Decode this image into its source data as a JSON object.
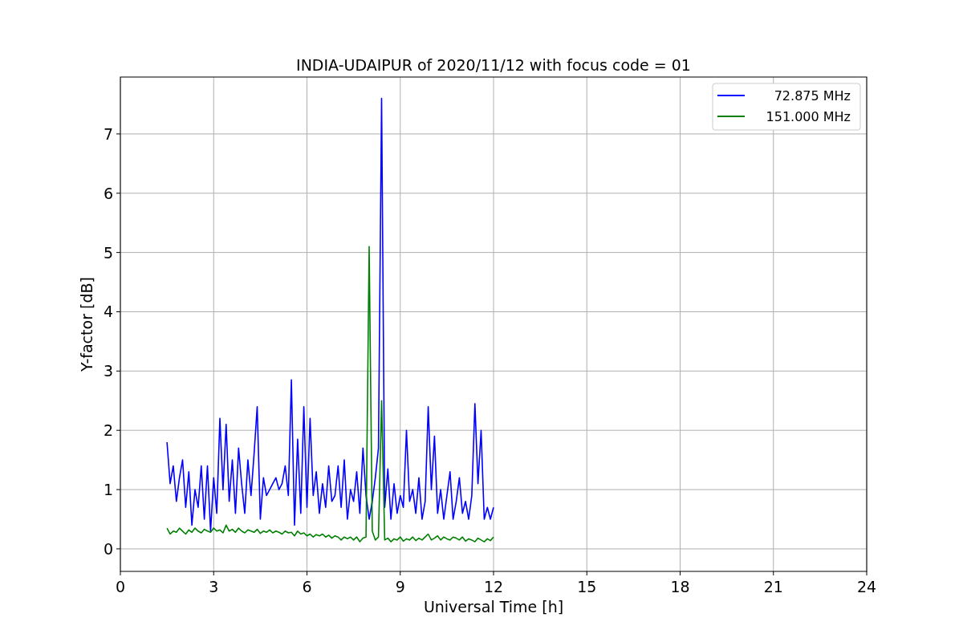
{
  "figure": {
    "chart_data": {
      "type": "line",
      "title": "INDIA-UDAIPUR of 2020/11/12 with focus code = 01",
      "xlabel": "Universal Time [h]",
      "ylabel": "Y-factor [dB]",
      "x": [
        1.5,
        1.6,
        1.7,
        1.8,
        1.9,
        2.0,
        2.1,
        2.2,
        2.3,
        2.4,
        2.5,
        2.6,
        2.7,
        2.8,
        2.9,
        3.0,
        3.1,
        3.2,
        3.3,
        3.4,
        3.5,
        3.6,
        3.7,
        3.8,
        3.9,
        4.0,
        4.1,
        4.2,
        4.3,
        4.4,
        4.5,
        4.6,
        4.7,
        4.8,
        4.9,
        5.0,
        5.1,
        5.2,
        5.3,
        5.4,
        5.5,
        5.6,
        5.7,
        5.8,
        5.9,
        6.0,
        6.1,
        6.2,
        6.3,
        6.4,
        6.5,
        6.6,
        6.7,
        6.8,
        6.9,
        7.0,
        7.1,
        7.2,
        7.3,
        7.4,
        7.5,
        7.6,
        7.7,
        7.8,
        7.9,
        8.0,
        8.1,
        8.2,
        8.3,
        8.4,
        8.5,
        8.6,
        8.7,
        8.8,
        8.9,
        9.0,
        9.1,
        9.2,
        9.3,
        9.4,
        9.5,
        9.6,
        9.7,
        9.8,
        9.9,
        10.0,
        10.1,
        10.2,
        10.3,
        10.4,
        10.5,
        10.6,
        10.7,
        10.8,
        10.9,
        11.0,
        11.1,
        11.2,
        11.3,
        11.4,
        11.5,
        11.6,
        11.7,
        11.8,
        11.9,
        12.0
      ],
      "series": [
        {
          "name": "72.875 MHz",
          "color": "#0000ff",
          "values": [
            1.8,
            1.1,
            1.4,
            0.8,
            1.2,
            1.5,
            0.7,
            1.3,
            0.4,
            1.0,
            0.7,
            1.4,
            0.5,
            1.4,
            0.3,
            1.2,
            0.6,
            2.2,
            1.0,
            2.1,
            0.8,
            1.5,
            0.6,
            1.7,
            1.1,
            0.6,
            1.5,
            0.9,
            1.6,
            2.4,
            0.5,
            1.2,
            0.9,
            1.0,
            1.1,
            1.2,
            1.0,
            1.1,
            1.4,
            0.9,
            2.85,
            0.4,
            1.85,
            0.6,
            2.4,
            0.7,
            2.2,
            0.9,
            1.3,
            0.6,
            1.1,
            0.7,
            1.4,
            0.8,
            0.9,
            1.4,
            0.7,
            1.5,
            0.5,
            1.0,
            0.8,
            1.3,
            0.6,
            1.7,
            0.9,
            0.5,
            0.8,
            1.2,
            1.7,
            7.6,
            0.7,
            1.35,
            0.5,
            1.1,
            0.6,
            0.9,
            0.7,
            2.0,
            0.8,
            1.0,
            0.6,
            1.2,
            0.5,
            0.8,
            2.4,
            1.0,
            1.9,
            0.6,
            1.0,
            0.5,
            0.9,
            1.3,
            0.5,
            0.8,
            1.2,
            0.6,
            0.8,
            0.5,
            0.9,
            2.45,
            1.1,
            2.0,
            0.5,
            0.7,
            0.5,
            0.7
          ]
        },
        {
          "name": "151.000 MHz",
          "color": "#008000",
          "values": [
            0.35,
            0.25,
            0.3,
            0.28,
            0.35,
            0.3,
            0.25,
            0.32,
            0.28,
            0.35,
            0.3,
            0.27,
            0.33,
            0.3,
            0.28,
            0.35,
            0.3,
            0.32,
            0.27,
            0.4,
            0.3,
            0.33,
            0.28,
            0.35,
            0.3,
            0.27,
            0.32,
            0.3,
            0.28,
            0.33,
            0.26,
            0.3,
            0.28,
            0.32,
            0.27,
            0.3,
            0.28,
            0.25,
            0.3,
            0.27,
            0.28,
            0.22,
            0.3,
            0.25,
            0.27,
            0.22,
            0.25,
            0.2,
            0.24,
            0.22,
            0.25,
            0.2,
            0.23,
            0.18,
            0.22,
            0.2,
            0.15,
            0.2,
            0.17,
            0.2,
            0.15,
            0.2,
            0.12,
            0.18,
            0.2,
            5.1,
            0.3,
            0.15,
            0.2,
            2.5,
            0.15,
            0.18,
            0.12,
            0.17,
            0.15,
            0.2,
            0.13,
            0.17,
            0.15,
            0.2,
            0.14,
            0.18,
            0.15,
            0.2,
            0.25,
            0.15,
            0.18,
            0.22,
            0.15,
            0.2,
            0.17,
            0.15,
            0.2,
            0.18,
            0.15,
            0.2,
            0.13,
            0.17,
            0.15,
            0.12,
            0.18,
            0.15,
            0.12,
            0.17,
            0.14,
            0.2
          ]
        }
      ],
      "xlim": [
        0,
        24
      ],
      "ylim": [
        -0.38,
        7.96
      ],
      "xticks": [
        0,
        3,
        6,
        9,
        12,
        15,
        18,
        21,
        24
      ],
      "yticks": [
        0,
        1,
        2,
        3,
        4,
        5,
        6,
        7
      ],
      "grid": true,
      "legend": true
    }
  }
}
